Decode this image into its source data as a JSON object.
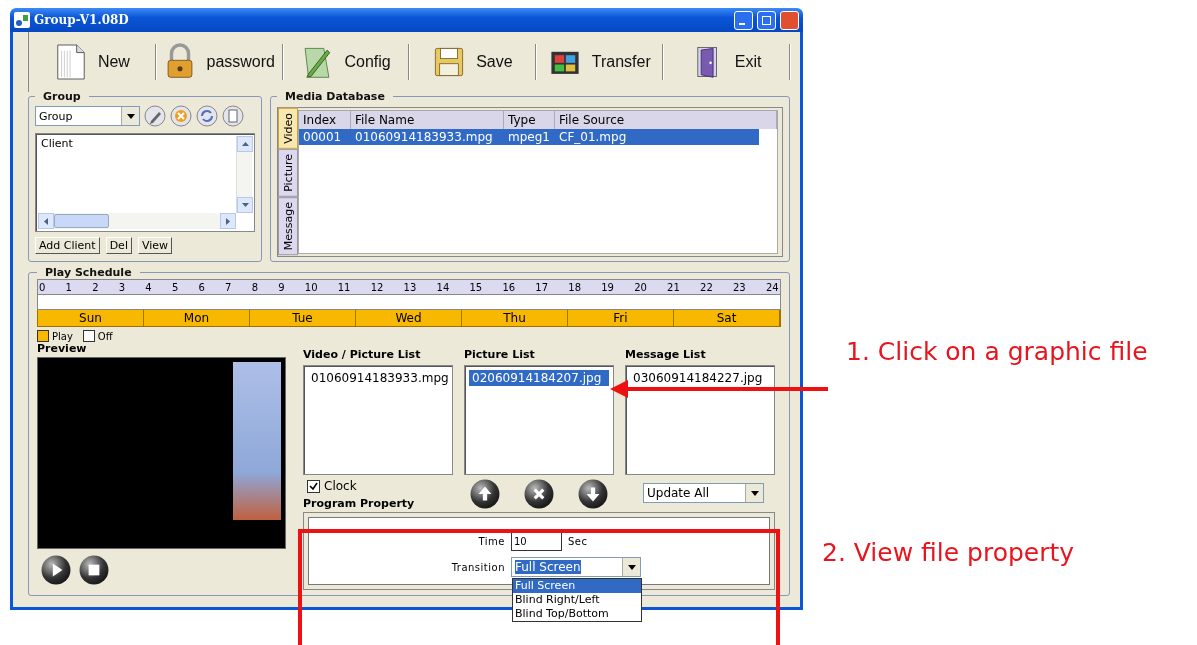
{
  "window": {
    "title": "Group-V1.08D"
  },
  "toolbar": [
    {
      "label": "New",
      "kind": "new"
    },
    {
      "label": "password",
      "kind": "password"
    },
    {
      "label": "Config",
      "kind": "config"
    },
    {
      "label": "Save",
      "kind": "save"
    },
    {
      "label": "Transfer",
      "kind": "transfer"
    },
    {
      "label": "Exit",
      "kind": "exit"
    }
  ],
  "group_panel": {
    "title": "Group",
    "combo": "Group",
    "tools": [
      {
        "kind": "edit"
      },
      {
        "kind": "delete"
      },
      {
        "kind": "refresh"
      },
      {
        "kind": "page"
      }
    ],
    "clients": [
      {
        "label": "Client",
        "selected": false
      }
    ],
    "buttons": [
      "Add Client",
      "Del",
      "View"
    ]
  },
  "media_database": {
    "title": "Media Database",
    "tabs": [
      {
        "label": "Video",
        "selected": true
      },
      {
        "label": "Picture",
        "selected": false
      },
      {
        "label": "Message",
        "selected": false
      }
    ],
    "columns": [
      "Index",
      "File Name",
      "Type",
      "File Source"
    ],
    "rows": [
      {
        "cells": [
          "00001",
          "01060914183933.mpg",
          "mpeg1",
          "CF_01.mpg"
        ],
        "selected": true
      }
    ]
  },
  "play_schedule": {
    "title": "Play Schedule",
    "hours": [
      "0",
      "1",
      "2",
      "3",
      "4",
      "5",
      "6",
      "7",
      "8",
      "9",
      "10",
      "11",
      "12",
      "13",
      "14",
      "15",
      "16",
      "17",
      "18",
      "19",
      "20",
      "21",
      "22",
      "23",
      "24"
    ],
    "days": [
      "Sun",
      "Mon",
      "Tue",
      "Wed",
      "Thu",
      "Fri",
      "Sat"
    ],
    "legend": [
      {
        "label": "Play",
        "on": true
      },
      {
        "label": "Off",
        "on": false
      }
    ]
  },
  "preview": {
    "title": "Preview",
    "controls": [
      {
        "kind": "play"
      },
      {
        "kind": "stop"
      }
    ]
  },
  "lists": [
    {
      "title": "Video / Picture List",
      "items": [
        {
          "label": "01060914183933.mpg",
          "selected": false
        }
      ]
    },
    {
      "title": "Picture List",
      "items": [
        {
          "label": "02060914184207.jpg",
          "selected": true
        }
      ]
    },
    {
      "title": "Message List",
      "items": [
        {
          "label": "03060914184227.jpg",
          "selected": false
        }
      ]
    }
  ],
  "clock": {
    "label": "Clock",
    "checked": true
  },
  "list_controls": [
    {
      "kind": "up"
    },
    {
      "kind": "delete"
    },
    {
      "kind": "down"
    }
  ],
  "update_combo": {
    "value": "Update All"
  },
  "program_property": {
    "title": "Program Property",
    "time_label": "Time",
    "time_value": "10",
    "time_unit": "Sec",
    "transition_label": "Transition",
    "transition_value": "Full Screen",
    "options": [
      {
        "label": "Full Screen",
        "selected": true
      },
      {
        "label": "Blind Right/Left",
        "selected": false
      },
      {
        "label": "Blind Top/Bottom",
        "selected": false
      }
    ]
  },
  "annotations": [
    {
      "text": "1. Click on a graphic file",
      "kind": "arrow"
    },
    {
      "text": "2. View file property",
      "kind": "frame"
    }
  ]
}
